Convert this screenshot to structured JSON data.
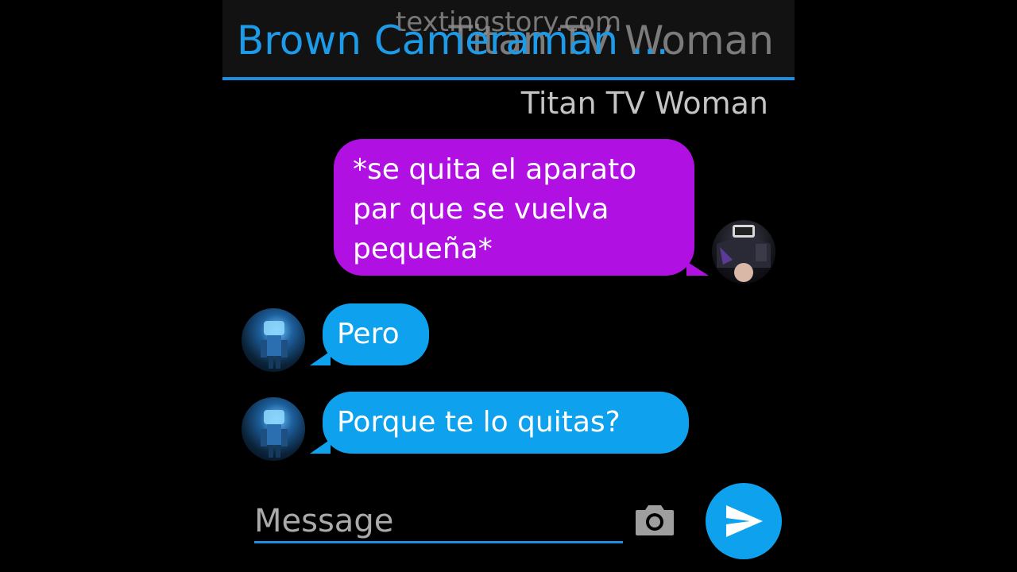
{
  "watermark": "textingstory.com",
  "header": {
    "title": "Brown Cameraman ...",
    "ghost_title": "Titan TV Woman"
  },
  "conversation": {
    "sender_name": "Titan TV Woman",
    "messages": [
      {
        "side": "right",
        "text": "*se quita el aparato par que se vuelva pequeña*"
      },
      {
        "side": "left",
        "text": "Pero"
      },
      {
        "side": "left",
        "text": "Porque te lo quitas?"
      }
    ]
  },
  "composer": {
    "placeholder": "Message",
    "camera_icon": "camera-icon",
    "send_icon": "send-icon"
  },
  "colors": {
    "accent_blue": "#0ea2ee",
    "outgoing_purple": "#b010e2",
    "header_title_blue": "#1e9be8"
  }
}
